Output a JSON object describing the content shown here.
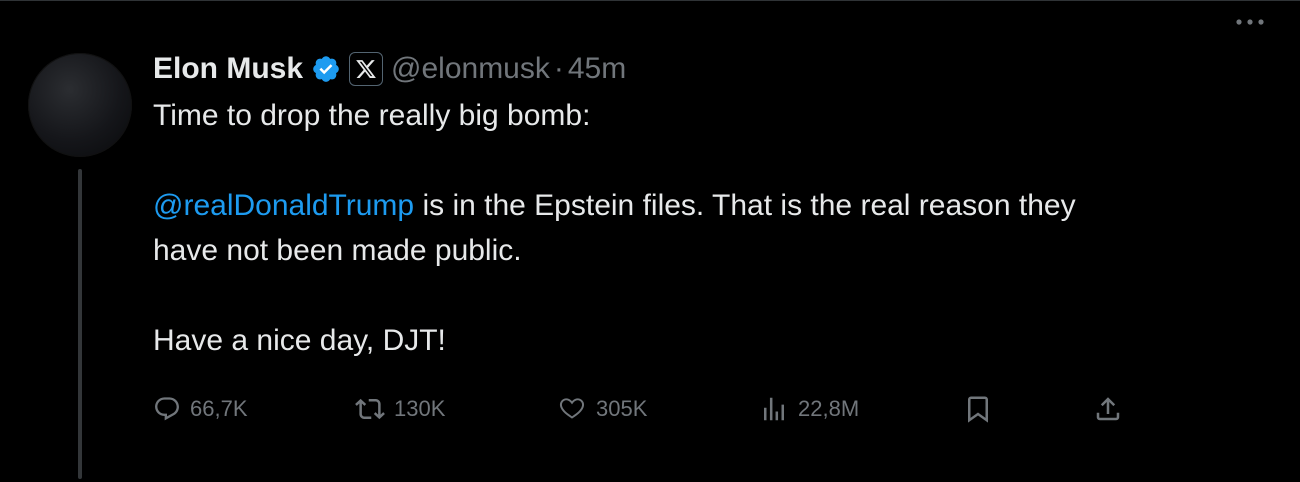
{
  "author": {
    "name": "Elon Musk",
    "handle": "@elonmusk",
    "separator": "·",
    "time": "45m"
  },
  "tweet": {
    "line1": "Time to drop the really big bomb:",
    "mention": "@realDonaldTrump",
    "line2_rest": " is in the Epstein files. That is the real reason they",
    "line3": "have not been made public.",
    "line4": "Have a nice day, DJT!"
  },
  "actions": {
    "replies": "66,7K",
    "reposts": "130K",
    "likes": "305K",
    "views": "22,8M"
  },
  "icons": {
    "verified": "verified-badge-icon",
    "affiliation": "x-logo-icon",
    "more": "more-dots-icon",
    "reply": "reply-icon",
    "repost": "repost-icon",
    "like": "heart-icon",
    "views": "views-chart-icon",
    "bookmark": "bookmark-icon",
    "share": "share-icon"
  },
  "colors": {
    "background": "#000000",
    "text": "#e7e9ea",
    "muted": "#71767b",
    "accent": "#1d9bf0"
  }
}
